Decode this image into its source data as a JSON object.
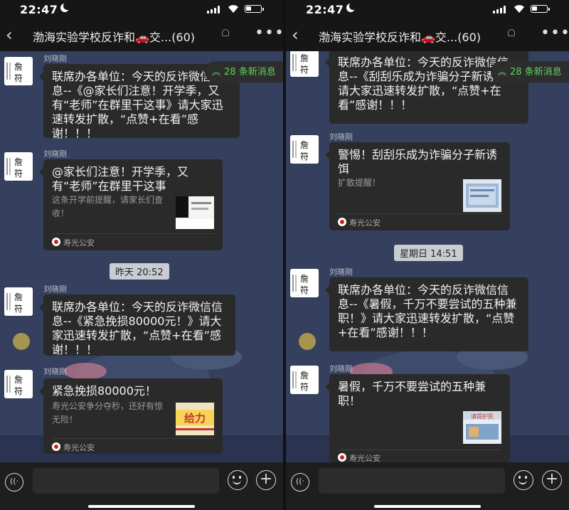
{
  "left": {
    "status": {
      "time": "22:47"
    },
    "header": {
      "title": "渤海实验学校反诈和🚗交...",
      "count": "(60)"
    },
    "new_messages": "28 条新消息",
    "messages": [
      {
        "sender": "刘晓刚",
        "text": "联席办各单位：今天的反诈微信信息--《@家长们注意！开学季，又有“老师”在群里干这事》请大家迅速转发扩散，“点赞+在看”感谢！！！"
      },
      {
        "sender": "刘晓刚",
        "card_title": "@家长们注意！开学季，又有“老师”在群里干这事",
        "card_desc": "这条开学前提醒，请家长们查收！",
        "source": "寿光公安"
      },
      {
        "sender": "刘晓刚",
        "text": "联席办各单位：今天的反诈微信信息--《紧急挽损80000元！》请大家迅速转发扩散，“点赞+在看”感谢！！！"
      },
      {
        "sender": "刘晓刚",
        "card_title": "紧急挽损80000元！",
        "card_desc": "寿光公安争分夺秒，还好有惊无险！",
        "source": "寿光公安",
        "thumb_text": "给力"
      }
    ],
    "timestamp": "昨天 20:52"
  },
  "right": {
    "status": {
      "time": "22:47"
    },
    "header": {
      "title": "渤海实验学校反诈和🚗交...",
      "count": "(60)"
    },
    "new_messages": "28 条新消息",
    "messages": [
      {
        "text": "联席办各单位：今天的反诈微信信息--《刮刮乐成为诈骗分子新诱饵》请大家迅速转发扩散，“点赞+在看”感谢！！！"
      },
      {
        "sender": "刘晓刚",
        "card_title": "警惕！刮刮乐成为诈骗分子新诱饵",
        "card_desc": "扩散提醒！",
        "source": "寿光公安"
      },
      {
        "sender": "刘晓刚",
        "text": "联席办各单位：今天的反诈微信信息--《暑假，千万不要尝试的五种兼职！》请大家迅速转发扩散，“点赞+在看”感谢！！！"
      },
      {
        "sender": "刘晓刚",
        "card_title": "暑假，千万不要尝试的五种兼职！",
        "source": "寿光公安",
        "thumb_text": "请提护民"
      }
    ],
    "timestamp": "星期日 14:51"
  },
  "avatar_text": "詹符",
  "colors": {
    "accent_green": "#5cd35c",
    "bubble": "#2a2a2a",
    "chat_bg": "#34405d"
  }
}
